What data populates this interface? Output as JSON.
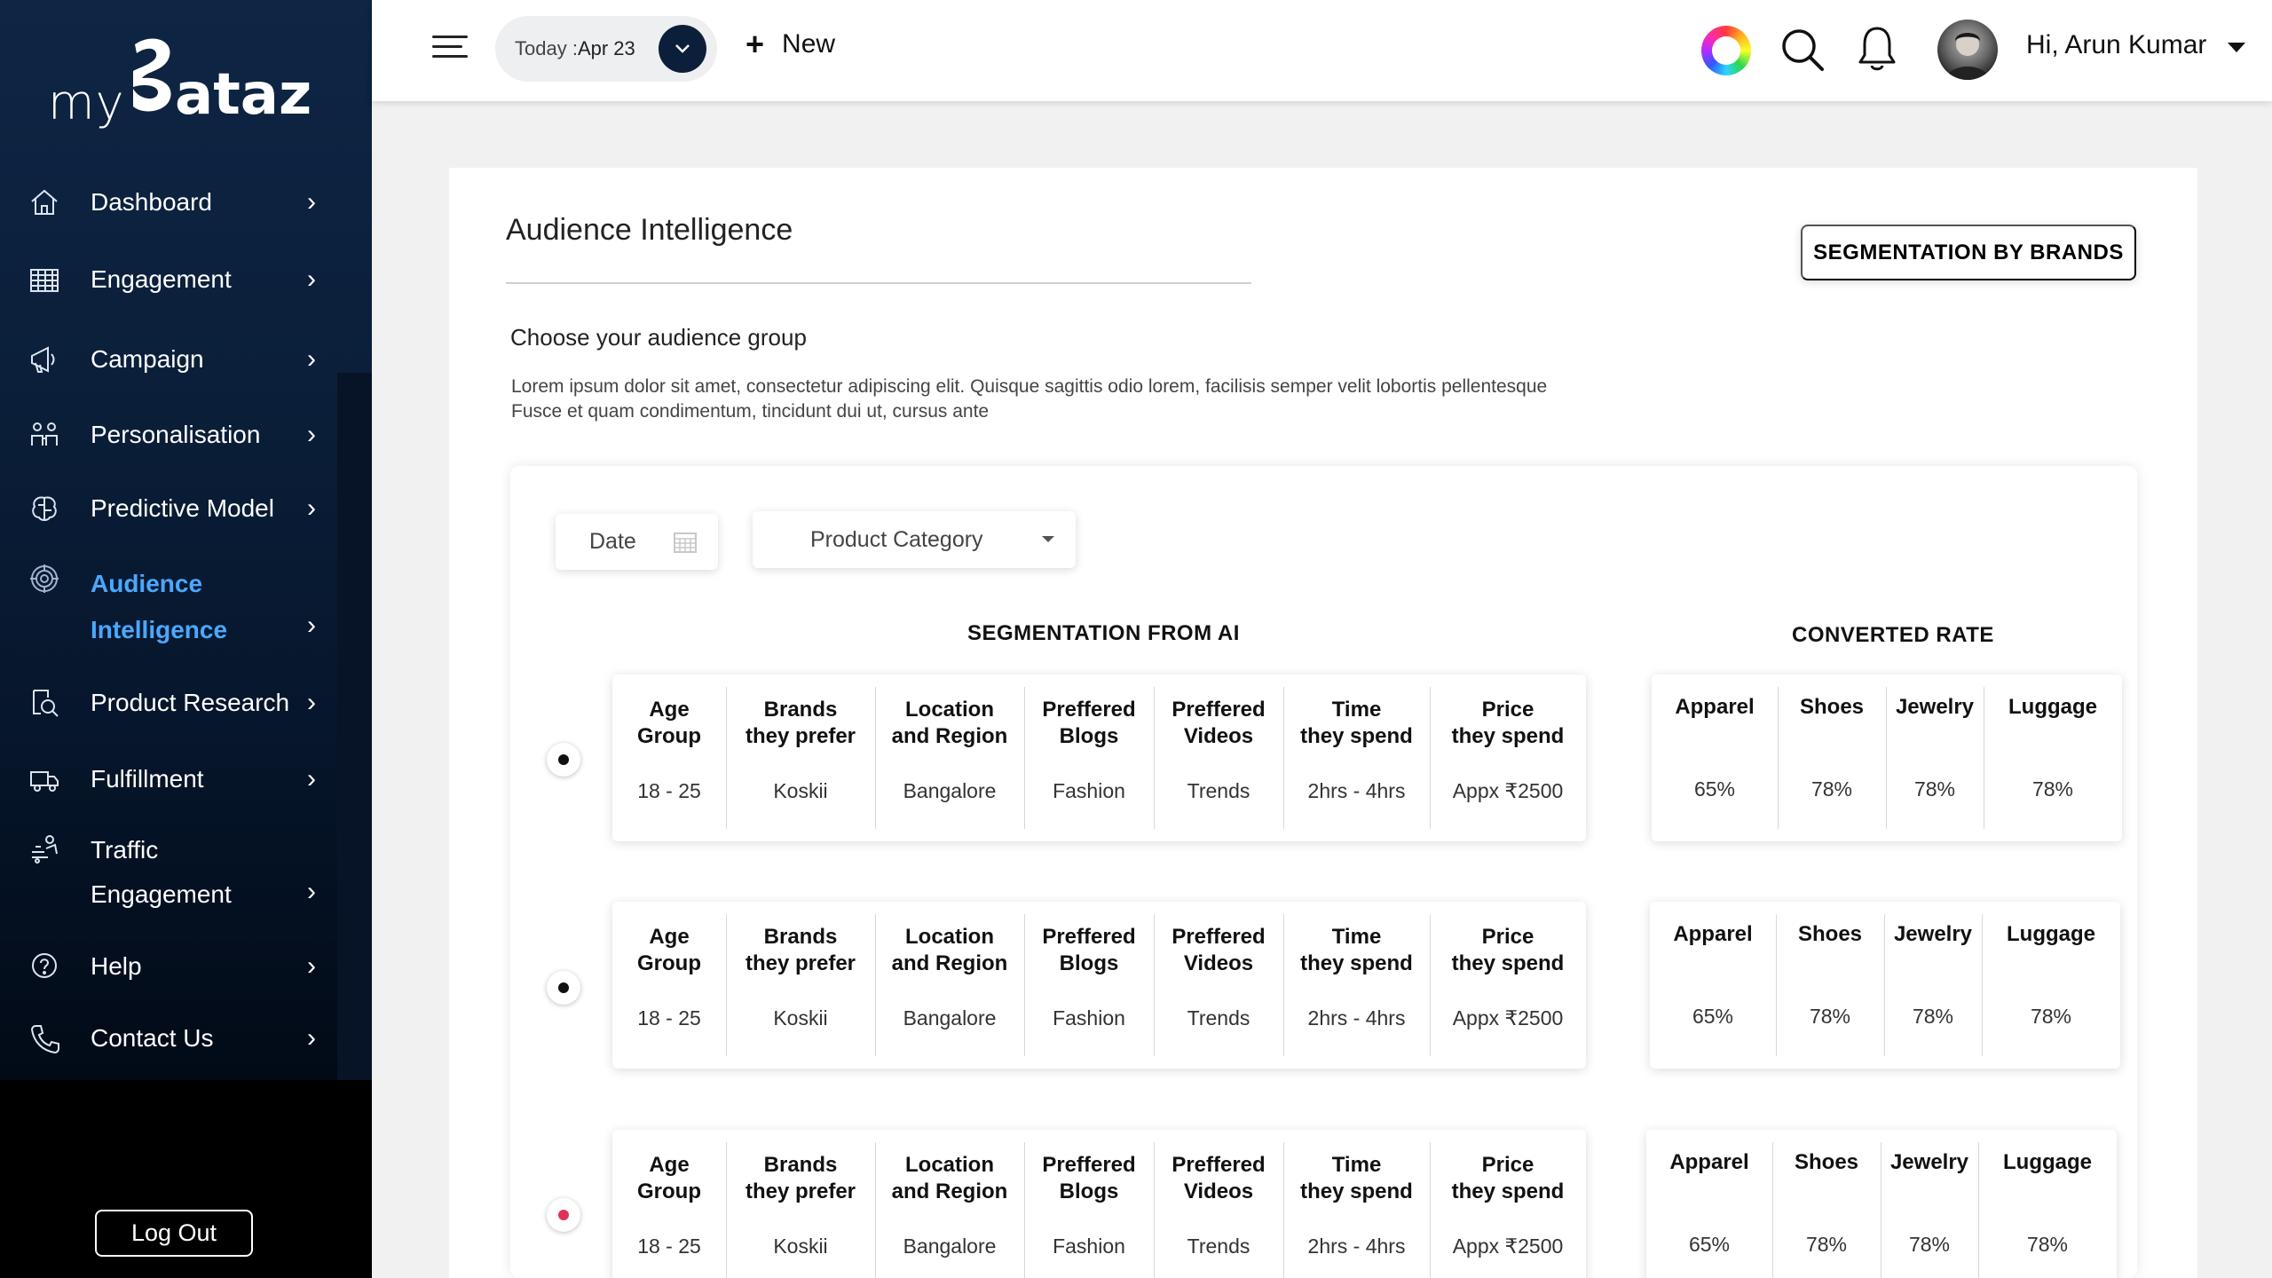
{
  "brand": {
    "logo_left": "my",
    "logo_right": "ataz"
  },
  "sidebar": {
    "items": [
      {
        "label": "Dashboard",
        "icon": "home-icon"
      },
      {
        "label": "Engagement",
        "icon": "grid-icon"
      },
      {
        "label": "Campaign",
        "icon": "megaphone-icon"
      },
      {
        "label": "Personalisation",
        "icon": "people-icon"
      },
      {
        "label": "Predictive Model",
        "icon": "brain-icon"
      },
      {
        "label_line1": "Audience",
        "label_line2": "Intelligence",
        "icon": "target-icon",
        "active": true
      },
      {
        "label": "Product Research",
        "icon": "magnifier-doc-icon"
      },
      {
        "label": "Fulfillment",
        "icon": "truck-icon"
      },
      {
        "label_line1": "Traffic",
        "label_line2": "Engagement",
        "icon": "traffic-icon"
      },
      {
        "label": "Help",
        "icon": "help-icon"
      },
      {
        "label": "Contact Us",
        "icon": "phone-icon"
      }
    ],
    "chevron": "›",
    "logout_label": "Log Out"
  },
  "topbar": {
    "date_label": "Today : ",
    "date_value": "Apr 23",
    "new_label": "New",
    "user_greeting": "Hi, Arun Kumar"
  },
  "main": {
    "title": "Audience Intelligence",
    "segmentation_button": "SEGMENTATION BY BRANDS",
    "subtitle": "Choose your audience group",
    "description_line1": "Lorem ipsum dolor sit amet, consectetur adipiscing elit. Quisque sagittis odio lorem, facilisis semper velit lobortis pellentesque",
    "description_line2": "Fusce et quam condimentum, tincidunt dui ut, cursus ante",
    "filters": {
      "date_label": "Date",
      "category_label": "Product Category"
    },
    "seg_heading": "SEGMENTATION FROM AI",
    "conv_heading": "CONVERTED RATE",
    "seg_headers": [
      [
        "Age",
        "Group"
      ],
      [
        "Brands",
        "they prefer"
      ],
      [
        "Location",
        "and Region"
      ],
      [
        "Preffered",
        "Blogs"
      ],
      [
        "Preffered",
        "Videos"
      ],
      [
        "Time",
        "they spend"
      ],
      [
        "Price",
        "they spend"
      ]
    ],
    "conv_headers": [
      "Apparel",
      "Shoes",
      "Jewelry",
      "Luggage"
    ],
    "rows": [
      {
        "selected": false,
        "seg": [
          "18 - 25",
          "Koskii",
          "Bangalore",
          "Fashion",
          "Trends",
          "2hrs - 4hrs",
          "Appx ₹2500"
        ],
        "conv": [
          "65%",
          "78%",
          "78%",
          "78%"
        ]
      },
      {
        "selected": false,
        "seg": [
          "18 - 25",
          "Koskii",
          "Bangalore",
          "Fashion",
          "Trends",
          "2hrs - 4hrs",
          "Appx ₹2500"
        ],
        "conv": [
          "65%",
          "78%",
          "78%",
          "78%"
        ]
      },
      {
        "selected": true,
        "seg": [
          "18 - 25",
          "Koskii",
          "Bangalore",
          "Fashion",
          "Trends",
          "2hrs - 4hrs",
          "Appx ₹2500"
        ],
        "conv": [
          "65%",
          "78%",
          "78%",
          "78%"
        ]
      }
    ]
  },
  "colors": {
    "sidebar_top": "#0e2544",
    "active_nav": "#4aa8ff",
    "date_button": "#0c1f3a",
    "selected_radio": "#e0305a"
  }
}
